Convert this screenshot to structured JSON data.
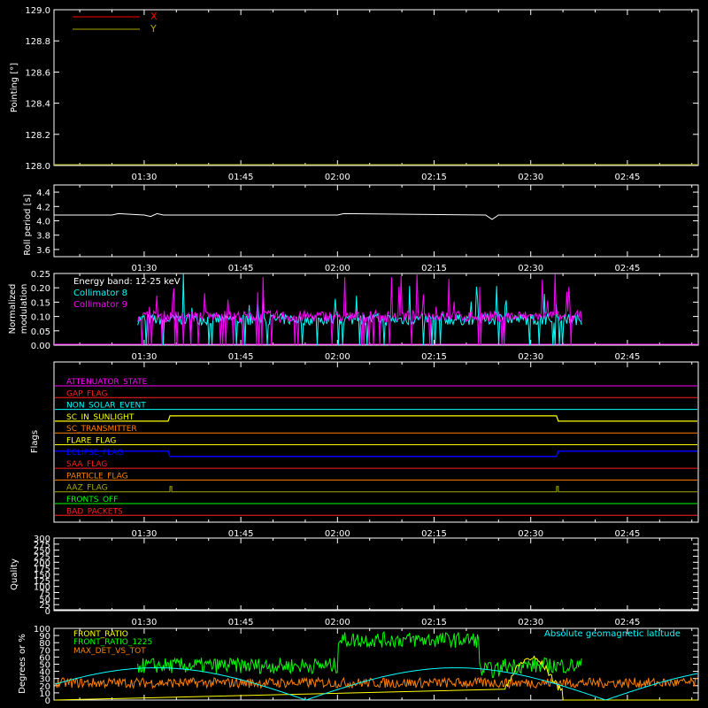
{
  "time_ticks": [
    "01:30",
    "01:45",
    "02:00",
    "02:15",
    "02:30",
    "02:45"
  ],
  "colors": {
    "background": "#000000",
    "axes": "#ffffff",
    "x": "#ff0000",
    "y": "#aaaa00",
    "white": "#ffffff",
    "cyan": "#00ffff",
    "magenta": "#ff00ff",
    "green": "#00ff00",
    "yellow": "#ffff00",
    "orange": "#ff8000",
    "blue": "#0000ff",
    "red": "#ff2020",
    "olive": "#aaaa00"
  },
  "chart_data": [
    {
      "type": "line",
      "panel": "pointing",
      "ylabel": "Pointing [°]",
      "ylim": [
        128.0,
        129.0
      ],
      "y_ticks": [
        "128.0",
        "128.2",
        "128.4",
        "128.6",
        "128.8",
        "129.0"
      ],
      "x_range": [
        "01:16",
        "02:56"
      ],
      "legend_placement": "top-left",
      "series": [
        {
          "name": "X",
          "color": "#ff0000",
          "values": [
            128.0,
            128.0
          ]
        },
        {
          "name": "Y",
          "color": "#aaaa00",
          "values": [
            128.0,
            128.0
          ]
        }
      ]
    },
    {
      "type": "line",
      "panel": "roll",
      "ylabel": "Roll period [s]",
      "ylim": [
        3.5,
        4.5
      ],
      "y_ticks": [
        "3.6",
        "3.8",
        "4.0",
        "4.2",
        "4.4"
      ],
      "series": [
        {
          "color": "#ffffff",
          "x": [
            "01:16",
            "01:25",
            "01:26",
            "01:30",
            "01:31",
            "01:32",
            "01:33",
            "01:34",
            "02:00",
            "02:01",
            "02:23",
            "02:24",
            "02:25",
            "02:56"
          ],
          "values": [
            4.08,
            4.08,
            4.1,
            4.08,
            4.06,
            4.1,
            4.08,
            4.08,
            4.08,
            4.1,
            4.08,
            4.02,
            4.08,
            4.08
          ]
        }
      ]
    },
    {
      "type": "line",
      "panel": "modulation",
      "ylabel": "Normalized modulation",
      "ylim": [
        0.0,
        0.25
      ],
      "y_ticks": [
        "0.00",
        "0.05",
        "0.10",
        "0.15",
        "0.20",
        "0.25"
      ],
      "annotation": "Energy band: 12-25 keV",
      "series": [
        {
          "name": "Collimator 8",
          "color": "#00ffff",
          "x_start": "01:29",
          "x_end": "02:38",
          "baseline": 0.09
        },
        {
          "name": "Collimator 9",
          "color": "#ff00ff",
          "x_start": "01:29",
          "x_end": "02:38",
          "baseline": 0.1
        }
      ]
    },
    {
      "type": "line",
      "panel": "flags",
      "ylabel": "Flags",
      "flags": [
        {
          "name": "ATTENUATOR_STATE",
          "color": "#ff00ff"
        },
        {
          "name": "GAP_FLAG",
          "color": "#ff2020"
        },
        {
          "name": "NON_SOLAR_EVENT",
          "color": "#00ffff"
        },
        {
          "name": "SC_IN_SUNLIGHT",
          "color": "#ffff00"
        },
        {
          "name": "SC_TRANSMITTER",
          "color": "#ff8000"
        },
        {
          "name": "FLARE_FLAG",
          "color": "#ffff00"
        },
        {
          "name": "ECLIPSE_FLAG",
          "color": "#0000ff"
        },
        {
          "name": "SAA_FLAG",
          "color": "#ff2020"
        },
        {
          "name": "PARTICLE_FLAG",
          "color": "#ff8000"
        },
        {
          "name": "AAZ_FLAG",
          "color": "#aaaa00"
        },
        {
          "name": "FRONTS_OFF",
          "color": "#00ff00"
        },
        {
          "name": "BAD_PACKETS",
          "color": "#ff2020"
        }
      ],
      "sunlight_interval": [
        "01:34",
        "02:34"
      ],
      "eclipse_off_interval": [
        "01:34",
        "02:34"
      ],
      "aaz_spikes": [
        "01:34",
        "02:34"
      ]
    },
    {
      "type": "line",
      "panel": "quality",
      "ylabel": "Quality",
      "ylim": [
        0,
        300
      ],
      "y_ticks": [
        "0",
        "25",
        "50",
        "75",
        "100",
        "125",
        "150",
        "175",
        "200",
        "225",
        "250",
        "275",
        "300"
      ]
    },
    {
      "type": "line",
      "panel": "ratios",
      "ylabel": "Degrees or %",
      "ylim": [
        0,
        100
      ],
      "y_ticks": [
        "0",
        "10",
        "20",
        "30",
        "40",
        "50",
        "60",
        "70",
        "80",
        "90",
        "100"
      ],
      "annotation": "Absolute geomagnetic latitude",
      "series": [
        {
          "name": "FRONT_RATIO",
          "color": "#ffff00"
        },
        {
          "name": "FRONT_RATIO_1225",
          "color": "#00ff00"
        },
        {
          "name": "MAX_DET_VS_TOT",
          "color": "#ff8000"
        }
      ]
    }
  ]
}
